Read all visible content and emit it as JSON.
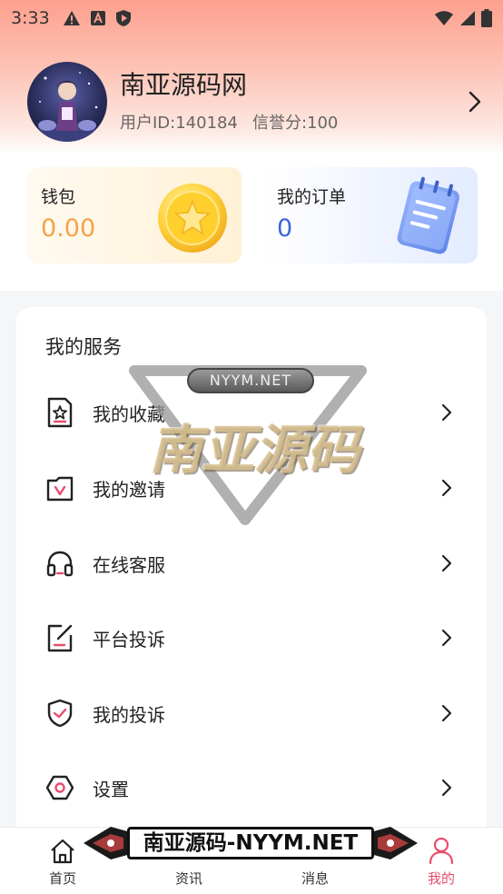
{
  "status_bar": {
    "time": "3:33",
    "icons_left": [
      "warning-icon",
      "a-letter-icon",
      "shield-play-icon"
    ],
    "icons_right": [
      "wifi-icon",
      "signal-icon",
      "battery-icon"
    ]
  },
  "profile": {
    "name": "南亚源码网",
    "user_id": "用户ID:140184",
    "credit_score": "信誉分:100"
  },
  "cards": {
    "wallet": {
      "title": "钱包",
      "value": "0.00"
    },
    "orders": {
      "title": "我的订单",
      "value": "0"
    }
  },
  "services": {
    "title": "我的服务",
    "items": [
      {
        "label": "我的收藏",
        "icon": "favorites-icon"
      },
      {
        "label": "我的邀请",
        "icon": "invite-icon"
      },
      {
        "label": "在线客服",
        "icon": "headset-icon"
      },
      {
        "label": "平台投诉",
        "icon": "complaint-edit-icon"
      },
      {
        "label": "我的投诉",
        "icon": "shield-check-icon"
      },
      {
        "label": "设置",
        "icon": "settings-hexagon-icon"
      }
    ]
  },
  "watermark": {
    "pill": "NYYM.NET",
    "main": "南亚源码"
  },
  "banner": {
    "text": "南亚源码-NYYM.NET"
  },
  "tabbar": {
    "tabs": [
      {
        "label": "首页",
        "icon": "home-icon"
      },
      {
        "label": "资讯",
        "icon": "news-icon"
      },
      {
        "label": "消息",
        "icon": "message-icon"
      },
      {
        "label": "我的",
        "icon": "user-icon",
        "active": true
      }
    ]
  },
  "colors": {
    "accent": "#e84d6c",
    "wallet_value": "#f4a24a",
    "order_value": "#3b66d6",
    "header_top": "#fda08e"
  }
}
